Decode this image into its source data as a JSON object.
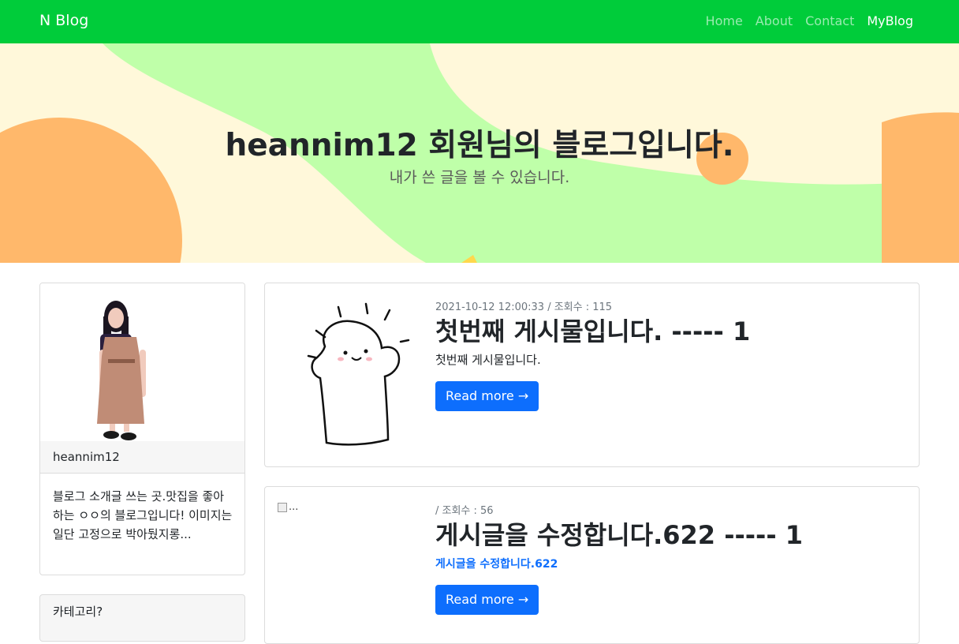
{
  "navbar": {
    "brand": "N Blog",
    "links": [
      "Home",
      "About",
      "Contact",
      "MyBlog"
    ],
    "colors": {
      "background": "#00cc3a"
    }
  },
  "hero": {
    "title": "heannim12 회원님의 블로그입니다.",
    "subtitle": "내가 쓴 글을 볼 수 있습니다.",
    "colors": {
      "background": "#fff8da",
      "blob_green": "#bfffa9",
      "blob_orange": "#ffb86b"
    }
  },
  "sidebar": {
    "profile": {
      "username": "heannim12",
      "description": "블로그 소개글 쓰는 곳.맛집을 좋아하는 ㅇㅇ의 블로그입니다! 이미지는 일단 고정으로 박아뒀지롱..."
    },
    "category": {
      "title": "카테고리?"
    }
  },
  "posts": [
    {
      "meta": "2021-10-12 12:00:33 / 조회수 : 115",
      "title": "첫번째 게시물입니다. ----- 1",
      "excerpt": "첫번째 게시물입니다.",
      "button": "Read more →",
      "thumbnail_icon": "cute-ghost-doodle"
    },
    {
      "meta": "/ 조회수 : 56",
      "title": "게시글을 수정합니다.622 ----- 1",
      "excerpt": "게시글을 수정합니다.622",
      "button": "Read more →",
      "thumbnail_alt": "..."
    }
  ]
}
